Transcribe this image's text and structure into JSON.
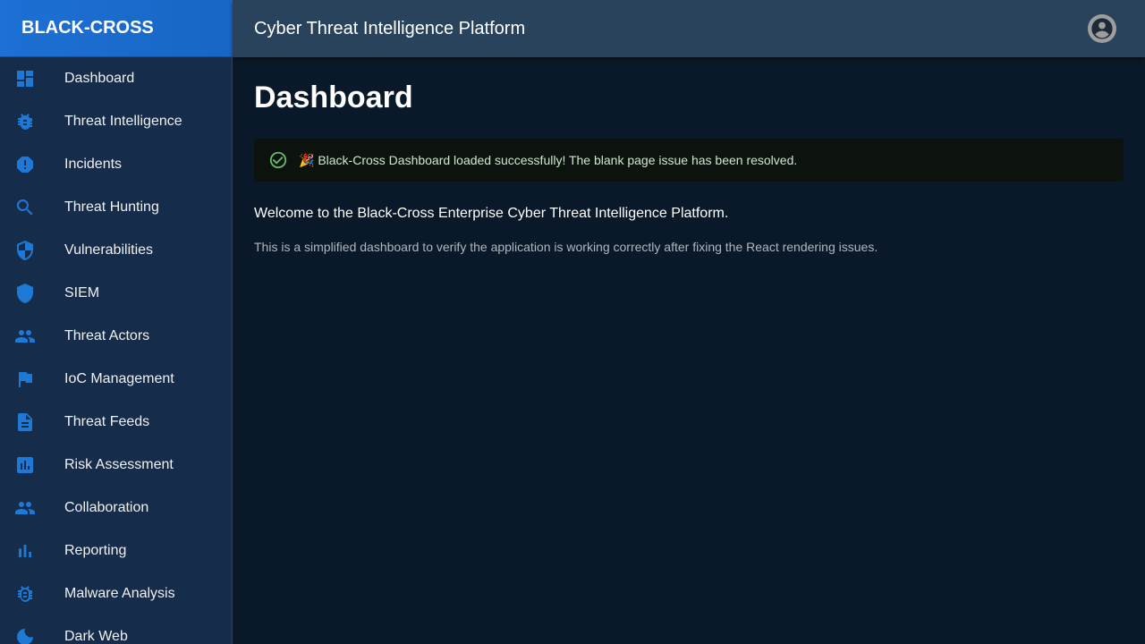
{
  "brand": "BLACK-CROSS",
  "header": {
    "title": "Cyber Threat Intelligence Platform",
    "avatar_icon": "account-circle-icon"
  },
  "sidebar": {
    "items": [
      {
        "label": "Dashboard",
        "icon": "dashboard-icon"
      },
      {
        "label": "Threat Intelligence",
        "icon": "bug-icon"
      },
      {
        "label": "Incidents",
        "icon": "report-icon"
      },
      {
        "label": "Threat Hunting",
        "icon": "search-icon"
      },
      {
        "label": "Vulnerabilities",
        "icon": "security-icon"
      },
      {
        "label": "SIEM",
        "icon": "shield-icon"
      },
      {
        "label": "Threat Actors",
        "icon": "people-icon"
      },
      {
        "label": "IoC Management",
        "icon": "flag-icon"
      },
      {
        "label": "Threat Feeds",
        "icon": "description-icon"
      },
      {
        "label": "Risk Assessment",
        "icon": "assessment-icon"
      },
      {
        "label": "Collaboration",
        "icon": "group-icon"
      },
      {
        "label": "Reporting",
        "icon": "bar-chart-icon"
      },
      {
        "label": "Malware Analysis",
        "icon": "bug-outline-icon"
      },
      {
        "label": "Dark Web",
        "icon": "moon-icon"
      }
    ]
  },
  "main": {
    "title": "Dashboard",
    "alert": "🎉 Black-Cross Dashboard loaded successfully! The blank page issue has been resolved.",
    "welcome": "Welcome to the Black-Cross Enterprise Cyber Threat Intelligence Platform.",
    "description": "This is a simplified dashboard to verify the application is working correctly after fixing the React rendering issues."
  },
  "colors": {
    "accent": "#1976d2",
    "success": "#66bb6a"
  }
}
